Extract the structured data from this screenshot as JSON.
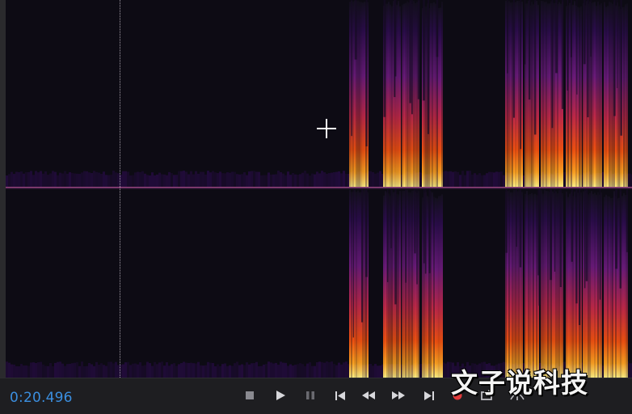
{
  "transport": {
    "current_time": "0:20.496",
    "buttons": [
      {
        "name": "stop-button",
        "icon": "stop-icon"
      },
      {
        "name": "play-button",
        "icon": "play-icon"
      },
      {
        "name": "pause-button",
        "icon": "pause-icon"
      },
      {
        "name": "skip-to-start-button",
        "icon": "skip-back-icon"
      },
      {
        "name": "rewind-button",
        "icon": "rewind-icon"
      },
      {
        "name": "fast-forward-button",
        "icon": "fast-forward-icon"
      },
      {
        "name": "skip-to-end-button",
        "icon": "skip-forward-icon"
      },
      {
        "name": "record-button",
        "icon": "record-icon"
      },
      {
        "name": "loop-button",
        "icon": "loop-icon"
      },
      {
        "name": "skip-selection-button",
        "icon": "skip-selection-icon"
      }
    ]
  },
  "watermark": "文子说科技",
  "colors": {
    "time_text": "#3b8fe0",
    "record": "#e23b3b",
    "spectrogram_palette": [
      "#0d0b14",
      "#2a0c4a",
      "#6a1a7a",
      "#c02848",
      "#f05010",
      "#fca020",
      "#fff080"
    ]
  }
}
